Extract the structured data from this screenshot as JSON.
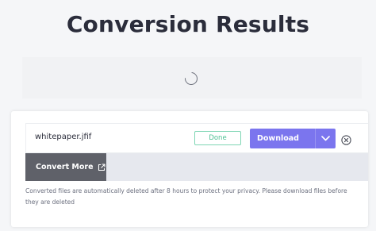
{
  "header": {
    "title": "Conversion Results"
  },
  "file": {
    "name": "whitepaper.jfif",
    "status": "Done",
    "download_label": "Download"
  },
  "actions": {
    "convert_more_label": "Convert More"
  },
  "notice": {
    "text": "Converted files are automatically deleted after 8 hours to protect your privacy. Please download files before they are deleted"
  },
  "icons": {
    "spinner": "loading-spinner-icon",
    "dropdown": "chevron-down-icon",
    "remove": "close-circle-icon",
    "external": "external-link-icon"
  },
  "colors": {
    "accent": "#7b75ee",
    "success": "#4fc094",
    "dark_button": "#5f6169",
    "title": "#2b2d3b"
  }
}
